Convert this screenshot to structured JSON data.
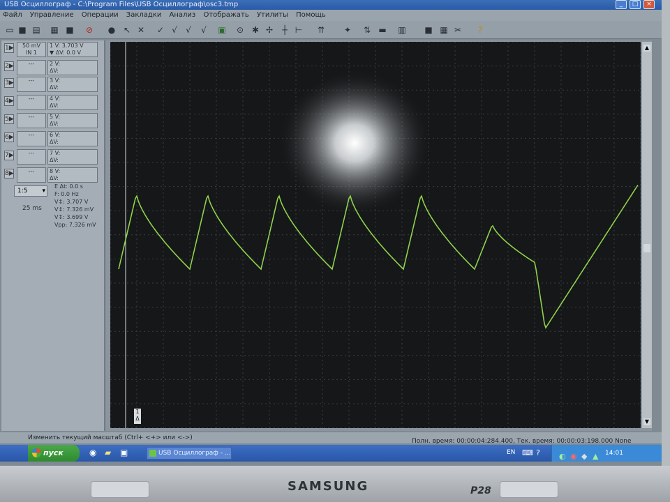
{
  "window": {
    "title": "USB Осциллограф - C:\\Program Files\\USB Осциллограф\\osc3.tmp",
    "minimize_glyph": "_",
    "maximize_glyph": "□",
    "close_glyph": "×"
  },
  "menu": [
    "Файл",
    "Управление",
    "Операции",
    "Закладки",
    "Анализ",
    "Отображать",
    "Утилиты",
    "Помощь"
  ],
  "toolbar_icons": [
    "open-icon",
    "save-icon",
    "print-icon",
    "copy-icon",
    "save-alt-icon",
    "stop-icon",
    "record-icon",
    "cursor-icon",
    "tools-icon",
    "check-icon",
    "check2-icon",
    "check3-icon",
    "check4-icon",
    "chart-icon",
    "zoom-icon",
    "marker-icon",
    "cross-icon",
    "cursor2-icon",
    "measure-icon",
    "trigger-icon",
    "filter-icon",
    "split-icon",
    "settings-icon",
    "stop-square-icon",
    "grid-icon",
    "close-tool-icon",
    "help-icon"
  ],
  "channel1": {
    "button": "1▶",
    "scale": "50 mV",
    "input": "IN 1",
    "v_line": "1 V: 3.703 V",
    "dv_line": "▼ ΔV: 0.0 V"
  },
  "channels": [
    {
      "button": "2▶",
      "num": "2",
      "v": "V:",
      "dv": "ΔV:"
    },
    {
      "button": "3▶",
      "num": "3",
      "v": "V:",
      "dv": "ΔV:"
    },
    {
      "button": "4▶",
      "num": "4",
      "v": "V:",
      "dv": "ΔV:"
    },
    {
      "button": "5▶",
      "num": "5",
      "v": "V:",
      "dv": "ΔV:"
    },
    {
      "button": "6▶",
      "num": "6",
      "v": "V:",
      "dv": "ΔV:"
    },
    {
      "button": "7▶",
      "num": "7",
      "v": "V:",
      "dv": "ΔV:"
    },
    {
      "button": "8▶",
      "num": "8",
      "v": "V:",
      "dv": "ΔV:"
    }
  ],
  "timebase": {
    "ratio": "1:5",
    "time_div": "25 ms"
  },
  "measurements": {
    "dt": "E Δt: 0.0 s",
    "freq": "F: 0.0 Hz",
    "v1": "V↕: 3.707 V",
    "v2": "V↕: 7.326 mV",
    "v3": "V↕: 3.699 V",
    "vpp": "Vpp: 7.326 mV"
  },
  "cursor_label": "1\nΔ",
  "status": {
    "hint": "Изменить текущий масштаб (Ctrl+ <+> или <->)",
    "time": "Полн. время: 00:00:04:284.400, Тек. время: 00:00:03:198.000  None"
  },
  "taskbar": {
    "start": "пуск",
    "app": "USB Осциллограф - ...",
    "lang": "EN",
    "clock": "14:01"
  },
  "bezel": {
    "brand": "SAMSUNG",
    "model": "P28"
  },
  "trace_color": "#8fd24a",
  "grid_color": "#3a3e42"
}
